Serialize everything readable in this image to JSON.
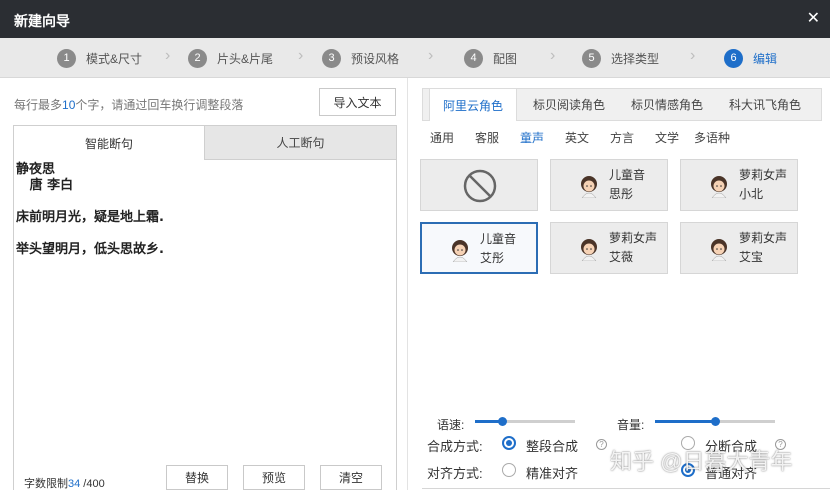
{
  "window": {
    "title": "新建向导",
    "close_icon": "close-icon"
  },
  "steps": [
    {
      "num": "1",
      "label": "模式&尺寸"
    },
    {
      "num": "2",
      "label": "片头&片尾"
    },
    {
      "num": "3",
      "label": "预设风格"
    },
    {
      "num": "4",
      "label": "配图"
    },
    {
      "num": "5",
      "label": "选择类型"
    },
    {
      "num": "6",
      "label": "编辑"
    }
  ],
  "active_step": 6,
  "editor": {
    "hint_before": "每行最多",
    "hint_num": "10",
    "hint_after": "个字，请通过回车换行调整段落",
    "import_button": "导入文本",
    "tabs": [
      "智能断句",
      "人工断句"
    ],
    "lines": [
      "静夜思",
      "   唐 李白",
      "床前明月光，疑是地上霜.",
      "举头望明月，低头思故乡."
    ],
    "word_limit_label": "字数限制",
    "word_count": "34",
    "word_max": " /400",
    "buttons": {
      "replace": "替换",
      "preview": "预览",
      "clear": "清空"
    }
  },
  "voice_panel": {
    "provider_tabs": [
      "阿里云角色",
      "标贝阅读角色",
      "标贝情感角色",
      "科大讯飞角色"
    ],
    "active_provider": 0,
    "categories": [
      "通用",
      "客服",
      "童声",
      "英文",
      "方言",
      "文学",
      "多语种"
    ],
    "active_category": 2,
    "voices": [
      {
        "kind": "none",
        "icon": "no-voice-icon"
      },
      {
        "line1": "儿童音",
        "line2": "思彤",
        "icon": "child-avatar-icon"
      },
      {
        "line1": "萝莉女声",
        "line2": "小北",
        "icon": "child-avatar-icon"
      },
      {
        "line1": "儿童音",
        "line2": "艾彤",
        "icon": "child-avatar-icon",
        "selected": true
      },
      {
        "line1": "萝莉女声",
        "line2": "艾薇",
        "icon": "child-avatar-icon"
      },
      {
        "line1": "萝莉女声",
        "line2": "艾宝",
        "icon": "child-avatar-icon"
      }
    ]
  },
  "settings": {
    "speed_label": "语速:",
    "speed_level": 0.27,
    "volume_label": "音量:",
    "volume_level": 0.5,
    "synthesis_label": "合成方式:",
    "synthesis_options": [
      "整段合成",
      "分断合成"
    ],
    "synthesis_selected": 0,
    "align_label": "对齐方式:",
    "align_options": [
      "精准对齐",
      "普通对齐"
    ],
    "align_selected": 1,
    "help_icon": "?"
  },
  "watermark": "知乎 @日暮大青年",
  "colors": {
    "accent": "#1e6ec9",
    "titlebar": "#2b2e33"
  }
}
